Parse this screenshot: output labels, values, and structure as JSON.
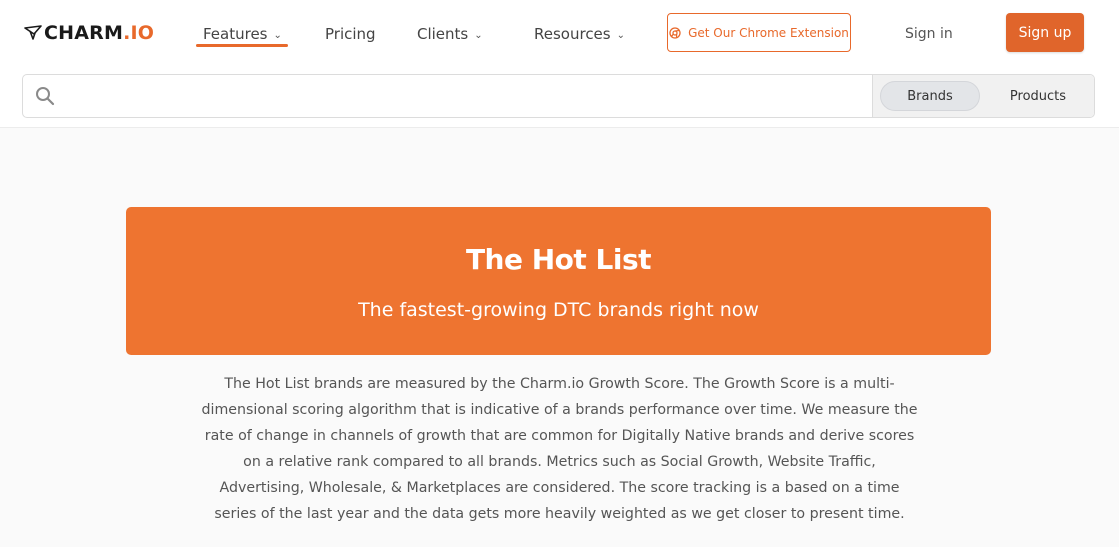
{
  "brand": {
    "name": "CHARM",
    "name_suffix": ".IO",
    "accent_color": "#e8692b"
  },
  "nav": {
    "items": [
      {
        "label": "Features",
        "has_dropdown": true,
        "active": true
      },
      {
        "label": "Pricing",
        "has_dropdown": false,
        "active": false
      },
      {
        "label": "Clients",
        "has_dropdown": true,
        "active": false
      },
      {
        "label": "Resources",
        "has_dropdown": true,
        "active": false
      }
    ],
    "chevron_icon": "chevron-down-icon"
  },
  "header_actions": {
    "extension_label": "Get Our Chrome Extension",
    "extension_icon": "chrome-icon",
    "signin_label": "Sign in",
    "signup_label": "Sign up"
  },
  "search": {
    "placeholder": "",
    "value": "",
    "icon": "search-icon",
    "toggles": [
      {
        "label": "Brands",
        "active": true
      },
      {
        "label": "Products",
        "active": false
      }
    ]
  },
  "hero": {
    "title": "The Hot List",
    "subtitle": "The fastest-growing DTC brands right now",
    "background_color": "#ee7430"
  },
  "description": {
    "text": "The Hot List brands are measured by the Charm.io Growth Score. The Growth Score is a multi-dimensional scoring algorithm that is indicative of a brands performance over time. We measure the rate of change in channels of growth that are common for Digitally Native brands and derive scores on a relative rank compared to all brands. Metrics such as Social Growth, Website Traffic, Advertising, Wholesale, & Marketplaces are considered. The score tracking is a based on a time series of the last year and the data gets more heavily weighted as we get closer to present time."
  }
}
